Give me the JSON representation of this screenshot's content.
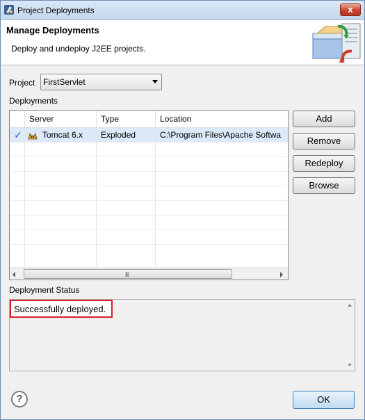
{
  "window": {
    "title": "Project Deployments",
    "close_glyph": "x"
  },
  "banner": {
    "title": "Manage Deployments",
    "description": "Deploy and undeploy J2EE projects."
  },
  "project": {
    "label": "Project",
    "selected": "FirstServlet"
  },
  "deployments": {
    "label": "Deployments",
    "columns": [
      "",
      "Server",
      "Type",
      "Location"
    ],
    "rows": [
      {
        "check": "✓",
        "server": "Tomcat  6.x",
        "type": "Exploded",
        "location": "C:\\Program Files\\Apache Softwa"
      }
    ],
    "scrollbar_grip": "III"
  },
  "buttons": {
    "add": "Add",
    "remove": "Remove",
    "redeploy": "Redeploy",
    "browse": "Browse",
    "ok": "OK",
    "help": "?"
  },
  "status": {
    "label": "Deployment Status",
    "message": "Successfully deployed."
  },
  "colors": {
    "highlight_border": "#d9202a",
    "selection": "#dbe9f8",
    "check": "#2f57b8"
  },
  "icons": {
    "title": "eclipse-window-icon",
    "banner": "deployment-server-icon",
    "row": "tomcat-icon"
  }
}
